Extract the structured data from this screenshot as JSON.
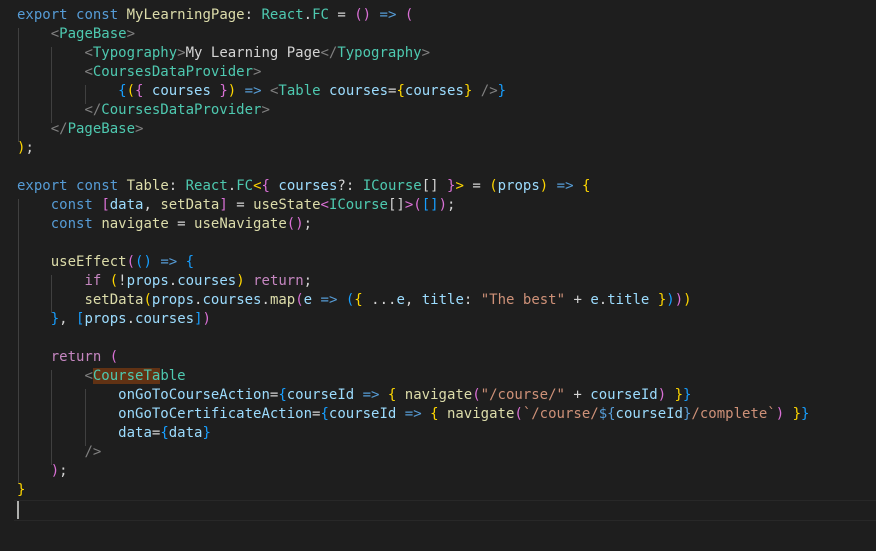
{
  "editor": {
    "language": "tsx",
    "theme_colors": {
      "background": "#1e1e1e",
      "keyword": "#569cd6",
      "control": "#c586c0",
      "function": "#dcdcaa",
      "type": "#4ec9b0",
      "variable": "#9cdcfe",
      "string": "#ce9178",
      "tag_punct": "#808080",
      "bracket_1": "#ffd700",
      "bracket_2": "#da70d6",
      "bracket_3": "#179fff",
      "match_highlight": "#613214"
    },
    "lines": [
      [
        [
          "k",
          "export"
        ],
        [
          "p",
          " "
        ],
        [
          "k",
          "const"
        ],
        [
          "p",
          " "
        ],
        [
          "f",
          "MyLearningPage"
        ],
        [
          "p",
          ": "
        ],
        [
          "t",
          "React"
        ],
        [
          "p",
          "."
        ],
        [
          "t",
          "FC"
        ],
        [
          "p",
          " = "
        ],
        [
          "b2",
          "()"
        ],
        [
          "p",
          " "
        ],
        [
          "k",
          "=>"
        ],
        [
          "p",
          " "
        ],
        [
          "b2",
          "("
        ]
      ],
      [
        [
          "p",
          "    "
        ],
        [
          "tg",
          "<"
        ],
        [
          "t",
          "PageBase"
        ],
        [
          "tg",
          ">"
        ]
      ],
      [
        [
          "p",
          "        "
        ],
        [
          "tg",
          "<"
        ],
        [
          "t",
          "Typography"
        ],
        [
          "tg",
          ">"
        ],
        [
          "p",
          "My Learning Page"
        ],
        [
          "tg",
          "</"
        ],
        [
          "t",
          "Typography"
        ],
        [
          "tg",
          ">"
        ]
      ],
      [
        [
          "p",
          "        "
        ],
        [
          "tg",
          "<"
        ],
        [
          "t",
          "CoursesDataProvider"
        ],
        [
          "tg",
          ">"
        ]
      ],
      [
        [
          "p",
          "            "
        ],
        [
          "b3",
          "{"
        ],
        [
          "b1",
          "("
        ],
        [
          "b2",
          "{"
        ],
        [
          "p",
          " "
        ],
        [
          "v",
          "courses"
        ],
        [
          "p",
          " "
        ],
        [
          "b2",
          "}"
        ],
        [
          "b1",
          ")"
        ],
        [
          "p",
          " "
        ],
        [
          "k",
          "=>"
        ],
        [
          "p",
          " "
        ],
        [
          "tg",
          "<"
        ],
        [
          "t",
          "Table"
        ],
        [
          "p",
          " "
        ],
        [
          "v",
          "courses"
        ],
        [
          "p",
          "="
        ],
        [
          "b1",
          "{"
        ],
        [
          "v",
          "courses"
        ],
        [
          "b1",
          "}"
        ],
        [
          "p",
          " "
        ],
        [
          "tg",
          "/>"
        ],
        [
          "b3",
          "}"
        ]
      ],
      [
        [
          "p",
          "        "
        ],
        [
          "tg",
          "</"
        ],
        [
          "t",
          "CoursesDataProvider"
        ],
        [
          "tg",
          ">"
        ]
      ],
      [
        [
          "p",
          "    "
        ],
        [
          "tg",
          "</"
        ],
        [
          "t",
          "PageBase"
        ],
        [
          "tg",
          ">"
        ]
      ],
      [
        [
          "b1",
          ")"
        ],
        [
          "p",
          ";"
        ]
      ],
      [],
      [
        [
          "k",
          "export"
        ],
        [
          "p",
          " "
        ],
        [
          "k",
          "const"
        ],
        [
          "p",
          " "
        ],
        [
          "f",
          "Table"
        ],
        [
          "p",
          ": "
        ],
        [
          "t",
          "React"
        ],
        [
          "p",
          "."
        ],
        [
          "t",
          "FC"
        ],
        [
          "b1",
          "<"
        ],
        [
          "b2",
          "{"
        ],
        [
          "p",
          " "
        ],
        [
          "v",
          "courses"
        ],
        [
          "p",
          "?: "
        ],
        [
          "t",
          "ICourse"
        ],
        [
          "p",
          "[] "
        ],
        [
          "b2",
          "}"
        ],
        [
          "b1",
          ">"
        ],
        [
          "p",
          " = "
        ],
        [
          "b1",
          "("
        ],
        [
          "v",
          "props"
        ],
        [
          "b1",
          ")"
        ],
        [
          "p",
          " "
        ],
        [
          "k",
          "=>"
        ],
        [
          "p",
          " "
        ],
        [
          "b1",
          "{"
        ]
      ],
      [
        [
          "p",
          "    "
        ],
        [
          "k",
          "const"
        ],
        [
          "p",
          " "
        ],
        [
          "b2",
          "["
        ],
        [
          "v",
          "data"
        ],
        [
          "p",
          ", "
        ],
        [
          "f",
          "setData"
        ],
        [
          "b2",
          "]"
        ],
        [
          "p",
          " = "
        ],
        [
          "f",
          "useState"
        ],
        [
          "b2",
          "<"
        ],
        [
          "t",
          "ICourse"
        ],
        [
          "p",
          "[]"
        ],
        [
          "b2",
          ">"
        ],
        [
          "b2",
          "("
        ],
        [
          "b3",
          "[]"
        ],
        [
          "b2",
          ")"
        ],
        [
          "p",
          ";"
        ]
      ],
      [
        [
          "p",
          "    "
        ],
        [
          "k",
          "const"
        ],
        [
          "p",
          " "
        ],
        [
          "f",
          "navigate"
        ],
        [
          "p",
          " = "
        ],
        [
          "f",
          "useNavigate"
        ],
        [
          "b2",
          "()"
        ],
        [
          "p",
          ";"
        ]
      ],
      [],
      [
        [
          "p",
          "    "
        ],
        [
          "f",
          "useEffect"
        ],
        [
          "b2",
          "("
        ],
        [
          "b3",
          "()"
        ],
        [
          "p",
          " "
        ],
        [
          "k",
          "=>"
        ],
        [
          "p",
          " "
        ],
        [
          "b3",
          "{"
        ]
      ],
      [
        [
          "p",
          "        "
        ],
        [
          "c",
          "if"
        ],
        [
          "p",
          " "
        ],
        [
          "b1",
          "("
        ],
        [
          "p",
          "!"
        ],
        [
          "v",
          "props"
        ],
        [
          "p",
          "."
        ],
        [
          "v",
          "courses"
        ],
        [
          "b1",
          ")"
        ],
        [
          "p",
          " "
        ],
        [
          "c",
          "return"
        ],
        [
          "p",
          ";"
        ]
      ],
      [
        [
          "p",
          "        "
        ],
        [
          "f",
          "setData"
        ],
        [
          "b1",
          "("
        ],
        [
          "v",
          "props"
        ],
        [
          "p",
          "."
        ],
        [
          "v",
          "courses"
        ],
        [
          "p",
          "."
        ],
        [
          "f",
          "map"
        ],
        [
          "b2",
          "("
        ],
        [
          "v",
          "e"
        ],
        [
          "p",
          " "
        ],
        [
          "k",
          "=>"
        ],
        [
          "p",
          " "
        ],
        [
          "b3",
          "("
        ],
        [
          "b1",
          "{"
        ],
        [
          "p",
          " ..."
        ],
        [
          "v",
          "e"
        ],
        [
          "p",
          ", "
        ],
        [
          "v",
          "title"
        ],
        [
          "p",
          ": "
        ],
        [
          "s",
          "\"The best\""
        ],
        [
          "p",
          " + "
        ],
        [
          "v",
          "e"
        ],
        [
          "p",
          "."
        ],
        [
          "v",
          "title"
        ],
        [
          "p",
          " "
        ],
        [
          "b1",
          "}"
        ],
        [
          "b3",
          ")"
        ],
        [
          "b2",
          ")"
        ],
        [
          "b1",
          ")"
        ]
      ],
      [
        [
          "p",
          "    "
        ],
        [
          "b3",
          "}"
        ],
        [
          "p",
          ", "
        ],
        [
          "b3",
          "["
        ],
        [
          "v",
          "props"
        ],
        [
          "p",
          "."
        ],
        [
          "v",
          "courses"
        ],
        [
          "b3",
          "]"
        ],
        [
          "b2",
          ")"
        ]
      ],
      [],
      [
        [
          "p",
          "    "
        ],
        [
          "c",
          "return"
        ],
        [
          "p",
          " "
        ],
        [
          "b2",
          "("
        ]
      ],
      [
        [
          "p",
          "        "
        ],
        [
          "tg",
          "<"
        ],
        [
          "thl",
          "CourseTa"
        ],
        [
          "t",
          "ble"
        ]
      ],
      [
        [
          "p",
          "            "
        ],
        [
          "v",
          "onGoToCourseAction"
        ],
        [
          "p",
          "="
        ],
        [
          "b3",
          "{"
        ],
        [
          "v",
          "courseId"
        ],
        [
          "p",
          " "
        ],
        [
          "k",
          "=>"
        ],
        [
          "p",
          " "
        ],
        [
          "b1",
          "{"
        ],
        [
          "p",
          " "
        ],
        [
          "f",
          "navigate"
        ],
        [
          "b2",
          "("
        ],
        [
          "s",
          "\"/course/\""
        ],
        [
          "p",
          " + "
        ],
        [
          "v",
          "courseId"
        ],
        [
          "b2",
          ")"
        ],
        [
          "p",
          " "
        ],
        [
          "b1",
          "}"
        ],
        [
          "b3",
          "}"
        ]
      ],
      [
        [
          "p",
          "            "
        ],
        [
          "v",
          "onGoToCertificateAction"
        ],
        [
          "p",
          "="
        ],
        [
          "b3",
          "{"
        ],
        [
          "v",
          "courseId"
        ],
        [
          "p",
          " "
        ],
        [
          "k",
          "=>"
        ],
        [
          "p",
          " "
        ],
        [
          "b1",
          "{"
        ],
        [
          "p",
          " "
        ],
        [
          "f",
          "navigate"
        ],
        [
          "b2",
          "("
        ],
        [
          "s",
          "`/course/"
        ],
        [
          "k",
          "${"
        ],
        [
          "v",
          "courseId"
        ],
        [
          "k",
          "}"
        ],
        [
          "s",
          "/complete`"
        ],
        [
          "b2",
          ")"
        ],
        [
          "p",
          " "
        ],
        [
          "b1",
          "}"
        ],
        [
          "b3",
          "}"
        ]
      ],
      [
        [
          "p",
          "            "
        ],
        [
          "v",
          "data"
        ],
        [
          "p",
          "="
        ],
        [
          "b3",
          "{"
        ],
        [
          "v",
          "data"
        ],
        [
          "b3",
          "}"
        ]
      ],
      [
        [
          "p",
          "        "
        ],
        [
          "tg",
          "/>"
        ]
      ],
      [
        [
          "p",
          "    "
        ],
        [
          "b2",
          ")"
        ],
        [
          "p",
          ";"
        ]
      ],
      [
        [
          "b1",
          "}"
        ]
      ],
      []
    ]
  }
}
